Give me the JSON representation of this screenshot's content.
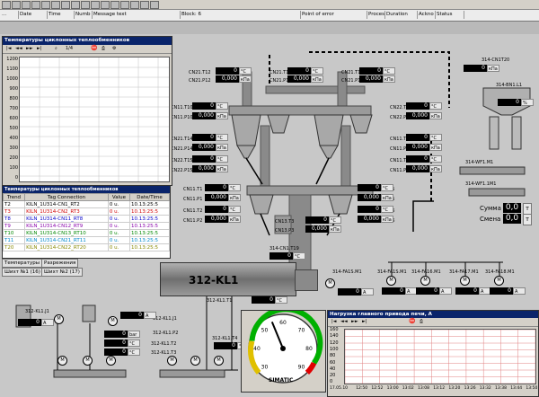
{
  "alarm_bar": {
    "columns": [
      {
        "key": "no",
        "label": "..."
      },
      {
        "key": "date",
        "label": "Date"
      },
      {
        "key": "time",
        "label": "Time"
      },
      {
        "key": "number",
        "label": "Numb"
      },
      {
        "key": "message",
        "label": "Message text"
      },
      {
        "key": "block",
        "label": "Block: 6"
      },
      {
        "key": "point",
        "label": "Point of error"
      },
      {
        "key": "process",
        "label": "Process"
      },
      {
        "key": "duration",
        "label": "Duration"
      },
      {
        "key": "ackn",
        "label": "Ackno"
      },
      {
        "key": "status",
        "label": "Status"
      }
    ]
  },
  "temp_window": {
    "title": "Температуры циклонных теплообменников",
    "toolbar_value": "1/4",
    "y_ticks": [
      "1200",
      "1100",
      "1000",
      "900",
      "800",
      "700",
      "600",
      "500",
      "400",
      "300",
      "200",
      "100",
      "0"
    ]
  },
  "trend_window": {
    "title": "Температуры циклонных теплообменников",
    "headers": [
      "Trend",
      "Tag Connection",
      "Value",
      "Date/Time"
    ],
    "rows": [
      {
        "trend": "T2",
        "tag": "KILN_1U314-CN1_RT2",
        "value": "0 u.",
        "time": "10.13:25:5",
        "color": "#000000"
      },
      {
        "trend": "T3",
        "tag": "KILN_1U314-CN2_RT3",
        "value": "0 u.",
        "time": "10.13:25:5",
        "color": "#d00000"
      },
      {
        "trend": "T8",
        "tag": "KILN_1U314-CN11_RT8",
        "value": "0 u.",
        "time": "10.13:25:5",
        "color": "#0000cc"
      },
      {
        "trend": "T9",
        "tag": "KILN_1U314-CN12_RT9",
        "value": "0 u.",
        "time": "10.13:25:5",
        "color": "#8800aa"
      },
      {
        "trend": "T10",
        "tag": "KILN_1U314-CN13_RT10",
        "value": "0 u.",
        "time": "10.13:25:5",
        "color": "#008800"
      },
      {
        "trend": "T11",
        "tag": "KILN_1U314-CN21_RT11",
        "value": "0 u.",
        "time": "10.13:25:5",
        "color": "#0088cc"
      },
      {
        "trend": "T20",
        "tag": "KILN_1U314-CN22_RT20",
        "value": "0 u.",
        "time": "10.13:25:5",
        "color": "#888800"
      }
    ]
  },
  "tabs": {
    "row1": [
      "Температуры",
      "Разрежения"
    ],
    "row2": [
      "Шихт №1 (16)",
      "Шихт №2 (17)"
    ]
  },
  "kiln": {
    "label": "312-KL1"
  },
  "readouts": [
    {
      "tag": "CN21.T12",
      "value": "0",
      "unit": "°C"
    },
    {
      "tag": "CN21.P12",
      "value": "0,000",
      "unit": "кПа"
    },
    {
      "tag": "CN21.T13",
      "value": "0",
      "unit": "°C"
    },
    {
      "tag": "CN21.P13",
      "value": "0,000",
      "unit": "кПа"
    },
    {
      "tag": "CN11.T10",
      "value": "0",
      "unit": "°C"
    },
    {
      "tag": "CN11.P10",
      "value": "0,000",
      "unit": "кПа"
    },
    {
      "tag": "CN21.T16",
      "value": "0",
      "unit": "°C"
    },
    {
      "tag": "CN21.P16",
      "value": "0,000",
      "unit": "кПа"
    },
    {
      "tag": "CN22.T4",
      "value": "0",
      "unit": "°C"
    },
    {
      "tag": "CN22.P4",
      "value": "0,000",
      "unit": "кПа"
    },
    {
      "tag": "CN21.T14",
      "value": "0",
      "unit": "°C"
    },
    {
      "tag": "CN21.P14",
      "value": "0,000",
      "unit": "кПа"
    },
    {
      "tag": "CN22.T15",
      "value": "0",
      "unit": "°C"
    },
    {
      "tag": "CN22.P15",
      "value": "0,000",
      "unit": "кПа"
    },
    {
      "tag": "CN11.T7",
      "value": "0",
      "unit": "°C"
    },
    {
      "tag": "CN11.P7",
      "value": "0,000",
      "unit": "кПа"
    },
    {
      "tag": "CN11.T8",
      "value": "0",
      "unit": "°C"
    },
    {
      "tag": "CN11.P8",
      "value": "0,000",
      "unit": "кПа"
    },
    {
      "tag": "CN22.T17",
      "value": "0",
      "unit": "°C"
    },
    {
      "tag": "CN22.P17",
      "value": "0,000",
      "unit": "кПа"
    },
    {
      "tag": "CN23.T18",
      "value": "0",
      "unit": "°C"
    },
    {
      "tag": "CN23.P18",
      "value": "0,000",
      "unit": "кПа"
    },
    {
      "tag": "CN11.T1",
      "value": "0",
      "unit": "°C"
    },
    {
      "tag": "CN11.P1",
      "value": "0,000",
      "unit": "кПа"
    },
    {
      "tag": "CN11.T2",
      "value": "0",
      "unit": "°C"
    },
    {
      "tag": "CN11.P2",
      "value": "0,000",
      "unit": "кПа"
    },
    {
      "tag": "CN13.T3",
      "value": "0",
      "unit": "°C"
    },
    {
      "tag": "CN13.P3",
      "value": "0,000",
      "unit": "кПа"
    },
    {
      "tag": "CN21.T5",
      "value": "0",
      "unit": "°C"
    },
    {
      "tag": "CN21.P5",
      "value": "0,000",
      "unit": "кПа"
    },
    {
      "tag": "CN14.T6",
      "value": "0",
      "unit": "°C"
    },
    {
      "tag": "CN14.P6",
      "value": "0,000",
      "unit": "кПа"
    },
    {
      "tag": "314-CN1.T19",
      "value": "0",
      "unit": "°C"
    },
    {
      "tag": "314-CN1.P19",
      "value": "0,000",
      "unit": "кПа"
    }
  ],
  "right_panel": {
    "tag_top": "314-CN1T20",
    "tag_top_value": "0",
    "tag_top_unit": "кПа",
    "bin_tag": "314-BN1.L1",
    "bin_value": "0",
    "bin_unit": "%",
    "wf_tag1": "314-WF1.M1",
    "wf_tag2": "314-WF1.1M1",
    "sum_label": "Сумма",
    "sum_value": "0,0",
    "sum_unit": "т",
    "shift_label": "Смена",
    "shift_value": "0,0",
    "shift_unit": "т"
  },
  "fan_tags": [
    {
      "tag": "314-FA1S.M1",
      "value": "0",
      "unit": "A"
    },
    {
      "tag": "314-FA16.M1",
      "value": "0",
      "unit": "A"
    },
    {
      "tag": "314-FA17.M1",
      "value": "0",
      "unit": "A"
    },
    {
      "tag": "314-FA18.M1",
      "value": "0",
      "unit": "A"
    }
  ],
  "kiln_area": {
    "fan_tag": "314-FA1S.M1",
    "fan_value": "0",
    "fan_unit": "A",
    "kl1_tags": [
      {
        "tag": "312-KL1.T1",
        "value": "0",
        "unit": "°C"
      },
      {
        "tag": "312-KL1.J1",
        "value": "0",
        "unit": "A"
      },
      {
        "tag": "312-KL1.J1",
        "value": "0",
        "unit": "A"
      },
      {
        "tag": "312-KL1.P2",
        "value": "0",
        "unit": "bar"
      },
      {
        "tag": "312-KL1.T2",
        "value": "0",
        "unit": "°C"
      },
      {
        "tag": "312-KL1.T3",
        "value": "0",
        "unit": "°C"
      },
      {
        "tag": "312-KL1.T4",
        "value": "0",
        "unit": "°C"
      }
    ]
  },
  "gauge": {
    "label": "SIMATIC",
    "value": 55,
    "min": 30,
    "max": 90,
    "ticks": [
      "30",
      "40",
      "50",
      "60",
      "70",
      "80",
      "90"
    ]
  },
  "load_window": {
    "title": "Нагрузка главного привода печи, А",
    "y_ticks": [
      "160",
      "140",
      "120",
      "100",
      "80",
      "60",
      "40",
      "20",
      "0"
    ],
    "x_ticks": [
      "17.05.10",
      "12:50",
      "12:52",
      "13:00",
      "13:02",
      "13:08",
      "13:12",
      "13:20",
      "13:26",
      "13:32",
      "13:38",
      "13:44",
      "13:50"
    ]
  },
  "colors": {
    "titlebar": "#0a246a",
    "readout_bg": "#000000",
    "grid": "#e08080"
  }
}
